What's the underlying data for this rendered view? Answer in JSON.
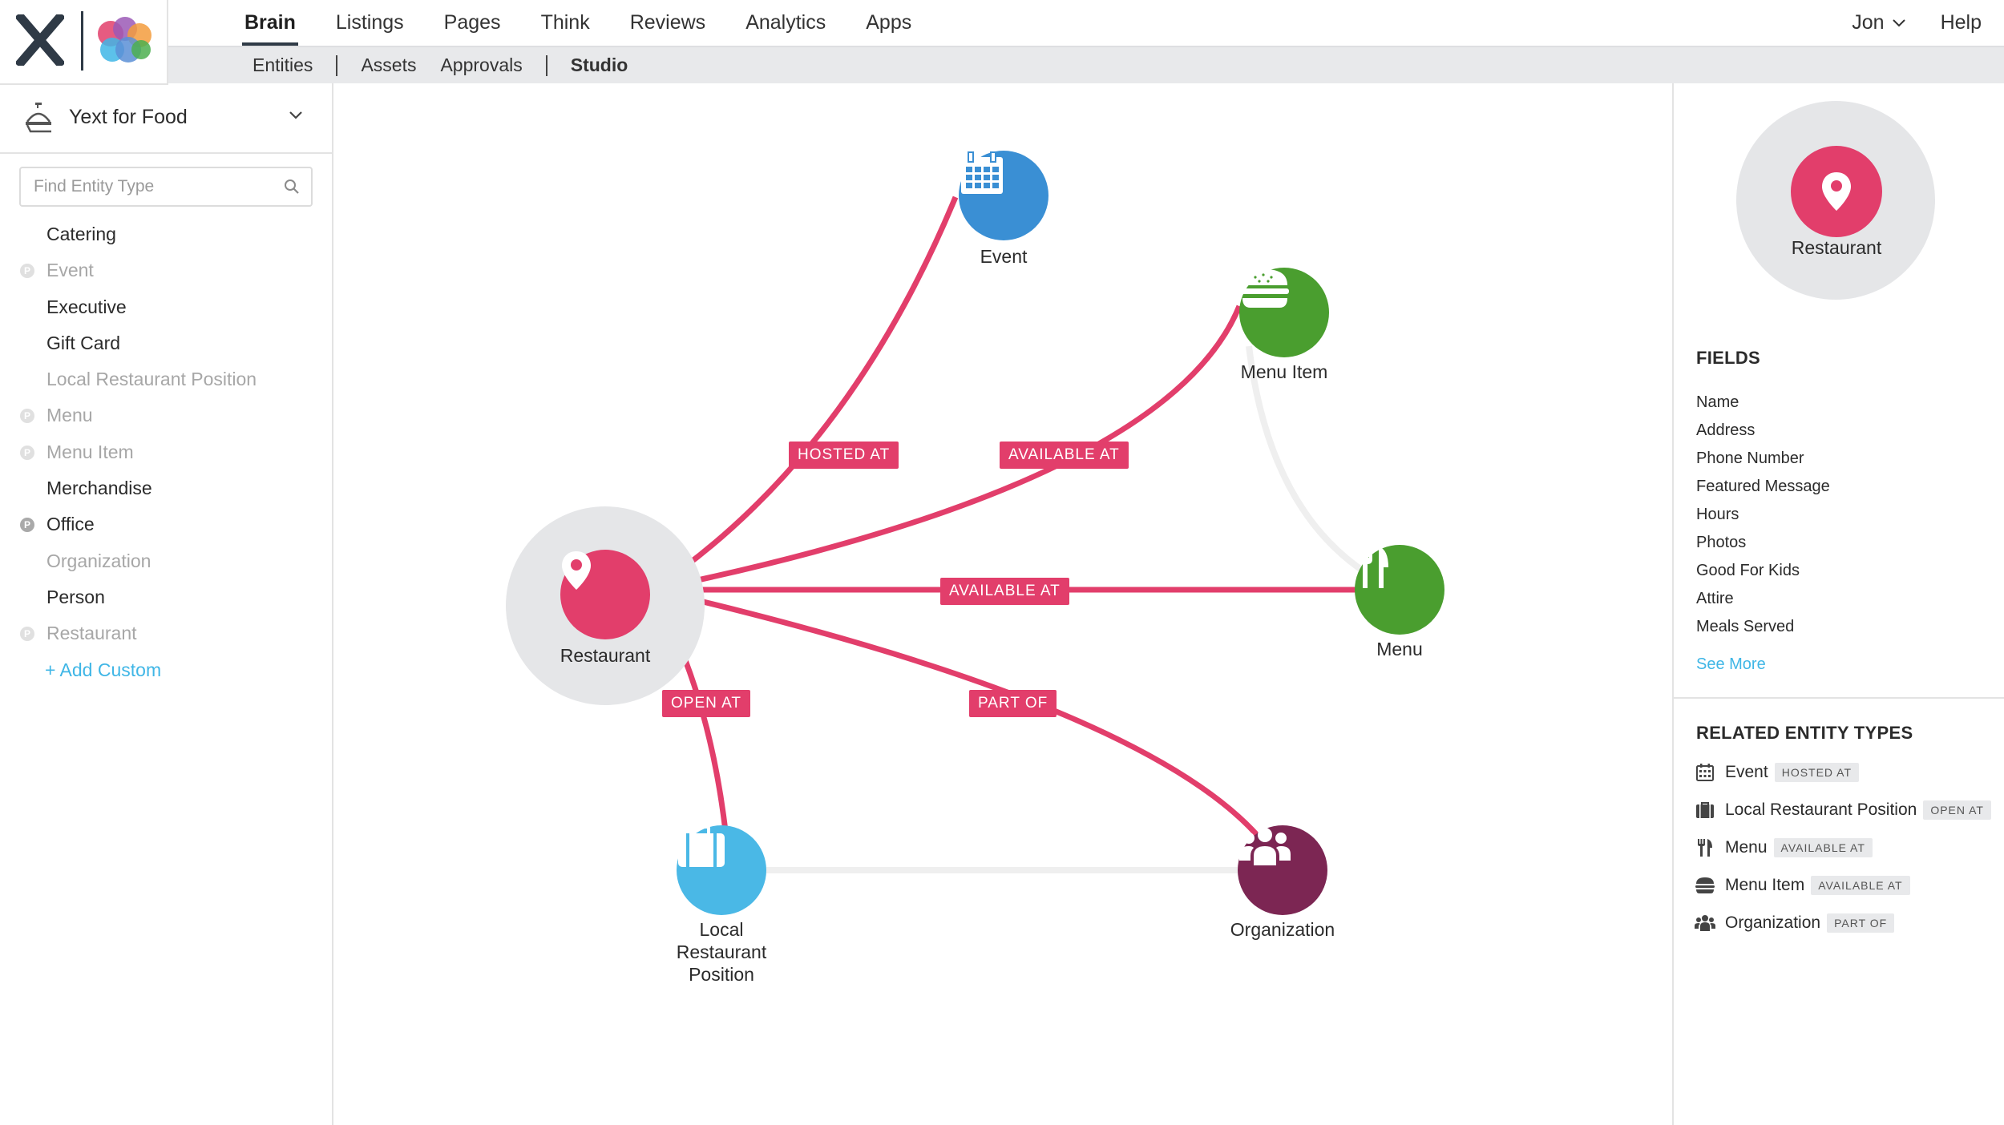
{
  "nav": {
    "tabs": [
      "Brain",
      "Listings",
      "Pages",
      "Think",
      "Reviews",
      "Analytics",
      "Apps"
    ],
    "active_tab": "Brain",
    "user": "Jon",
    "help": "Help"
  },
  "subnav": {
    "entities": "Entities",
    "assets": "Assets",
    "approvals": "Approvals",
    "studio": "Studio",
    "active": "Studio"
  },
  "sidebar": {
    "account": "Yext for Food",
    "search_placeholder": "Find Entity Type",
    "types": [
      {
        "label": "Catering",
        "badge": false,
        "dim": false
      },
      {
        "label": "Event",
        "badge": true,
        "dim": true
      },
      {
        "label": "Executive",
        "badge": false,
        "dim": false
      },
      {
        "label": "Gift Card",
        "badge": false,
        "dim": false
      },
      {
        "label": "Local Restaurant Position",
        "badge": false,
        "dim": true
      },
      {
        "label": "Menu",
        "badge": true,
        "dim": true
      },
      {
        "label": "Menu Item",
        "badge": true,
        "dim": true
      },
      {
        "label": "Merchandise",
        "badge": false,
        "dim": false
      },
      {
        "label": "Office",
        "badge": true,
        "dim": false
      },
      {
        "label": "Organization",
        "badge": false,
        "dim": true
      },
      {
        "label": "Person",
        "badge": false,
        "dim": false
      },
      {
        "label": "Restaurant",
        "badge": true,
        "dim": true
      }
    ],
    "badge_letter": "P",
    "add_custom": "+ Add Custom"
  },
  "graph": {
    "nodes": {
      "restaurant": {
        "label": "Restaurant",
        "color": "#e23e6b",
        "icon": "map-pin-icon"
      },
      "event": {
        "label": "Event",
        "color": "#3a8fd4",
        "icon": "calendar-icon"
      },
      "menu_item": {
        "label": "Menu Item",
        "color": "#4a9e2f",
        "icon": "burger-icon"
      },
      "menu": {
        "label": "Menu",
        "color": "#4a9e2f",
        "icon": "fork-knife-icon"
      },
      "local_position": {
        "label": "Local Restaurant Position",
        "color": "#4ab8e6",
        "icon": "briefcase-icon"
      },
      "organization": {
        "label": "Organization",
        "color": "#7c2653",
        "icon": "group-icon"
      }
    },
    "edges": {
      "hosted_at": "HOSTED AT",
      "available_at_menu_item": "AVAILABLE AT",
      "available_at_menu": "AVAILABLE AT",
      "open_at": "OPEN AT",
      "part_of": "PART OF"
    },
    "edge_color": "#e23e6b"
  },
  "panel": {
    "selected": "Restaurant",
    "fields_title": "FIELDS",
    "fields": [
      "Name",
      "Address",
      "Phone Number",
      "Featured Message",
      "Hours",
      "Photos",
      "Good For Kids",
      "Attire",
      "Meals Served"
    ],
    "see_more": "See More",
    "related_title": "RELATED ENTITY TYPES",
    "related": [
      {
        "label": "Event",
        "badge": "HOSTED AT",
        "icon": "calendar-icon"
      },
      {
        "label": "Local Restaurant Position",
        "badge": "OPEN AT",
        "icon": "briefcase-icon"
      },
      {
        "label": "Menu",
        "badge": "AVAILABLE AT",
        "icon": "fork-knife-icon"
      },
      {
        "label": "Menu Item",
        "badge": "AVAILABLE AT",
        "icon": "burger-icon"
      },
      {
        "label": "Organization",
        "badge": "PART OF",
        "icon": "group-icon"
      }
    ]
  }
}
